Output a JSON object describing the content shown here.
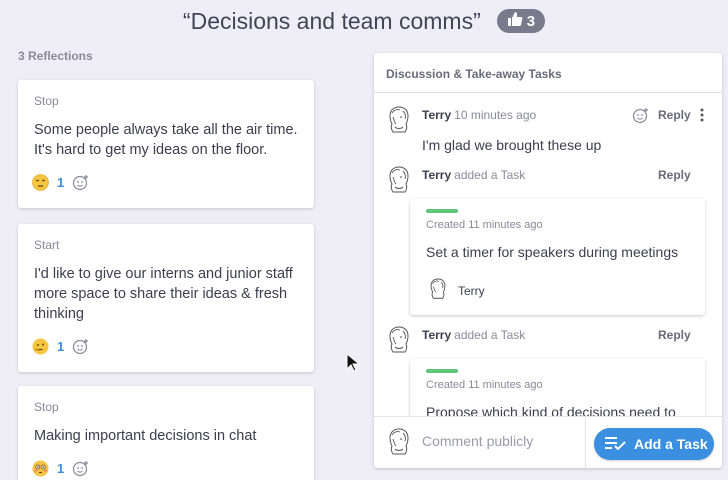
{
  "header": {
    "title": "“Decisions and team comms”",
    "vote_count": "3"
  },
  "reflections": {
    "count_label": "3 Reflections",
    "cards": [
      {
        "prompt": "Stop",
        "text": "Some people always take all the air time. It's hard to get my ideas on the floor.",
        "emoji": "unamused-face",
        "count": "1"
      },
      {
        "prompt": "Start",
        "text": "I'd like to give our interns and junior staff more space to share their ideas & fresh thinking",
        "emoji": "thinking-face",
        "count": "1"
      },
      {
        "prompt": "Stop",
        "text": "Making important decisions in chat",
        "emoji": "flushed-face",
        "count": "1"
      }
    ]
  },
  "discussion": {
    "title": "Discussion & Take-away Tasks",
    "comment": {
      "author": "Terry",
      "time": "10 minutes ago",
      "text": "I'm glad we brought these up",
      "reply_label": "Reply"
    },
    "tasks": [
      {
        "author": "Terry",
        "action": "added a Task",
        "reply_label": "Reply",
        "created": "Created 11 minutes ago",
        "text": "Set a timer for speakers during meetings",
        "owner": "Terry"
      },
      {
        "author": "Terry",
        "action": "added a Task",
        "reply_label": "Reply",
        "created": "Created 11 minutes ago",
        "text": "Propose which kind of decisions need to"
      }
    ],
    "composer": {
      "placeholder": "Comment publicly",
      "add_task_label": "Add a Task"
    }
  },
  "colors": {
    "background": "#efeef7",
    "accent": "#3a8fe0",
    "task_bar": "#5ec57c",
    "vote_badge": "#7a7a8c"
  }
}
